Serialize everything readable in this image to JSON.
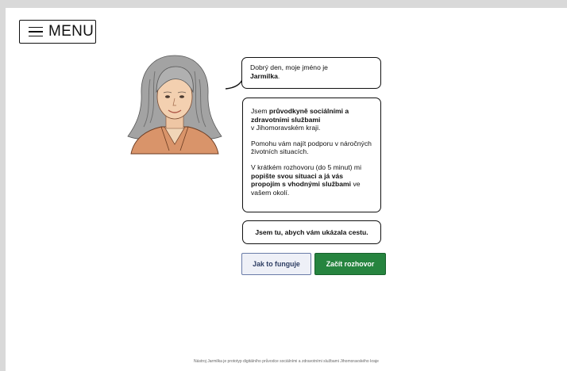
{
  "menu": {
    "label": "MENU"
  },
  "greeting": {
    "line1": "Dobrý den, moje jméno je",
    "name": "Jarmilka",
    "punct": "."
  },
  "intro": {
    "p1_pre": "Jsem ",
    "p1_bold": "průvodkyně sociálními a zdravotními službami",
    "p1_post": "v Jihomoravském kraji.",
    "p2": "Pomohu vám najít podporu v náročných životních situacích.",
    "p3_pre": "V krátkém rozhovoru (do 5 minut) mi ",
    "p3_bold": "popište svou situaci a já vás propojím s vhodnými službami",
    "p3_post": " ve vašem okolí."
  },
  "tagline": "Jsem tu, abych vám ukázala cestu.",
  "buttons": {
    "how_it_works": "Jak to funguje",
    "start": "Začít rozhovor"
  },
  "footer": "Nástroj Jarmilka je prototyp digitálního průvodce sociálními a zdravotními službami Jihomoravského kraje",
  "colors": {
    "primary": "#26843f",
    "secondary_text": "#2e3e63",
    "hair": "#9a9a9a",
    "blazer": "#d9946a"
  }
}
